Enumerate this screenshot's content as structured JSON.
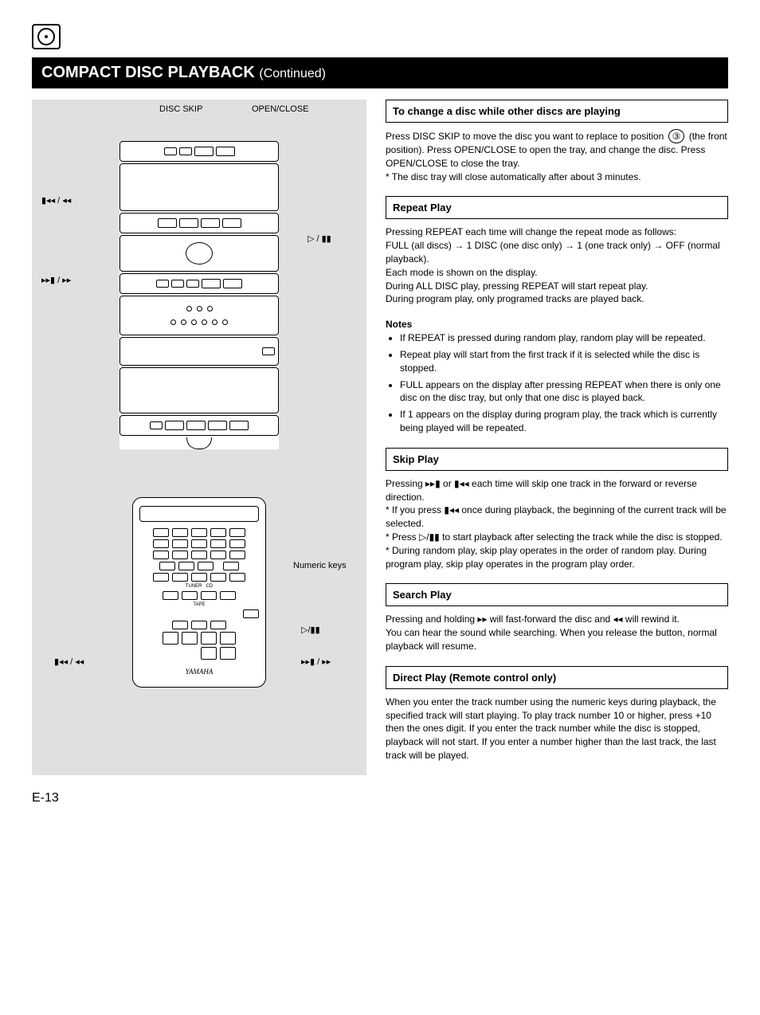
{
  "header": {
    "title_main": "COMPACT DISC PLAYBACK",
    "title_sub": "(Continued)"
  },
  "left": {
    "callouts": {
      "disc_skip": "DISC SKIP",
      "open_close": "OPEN/CLOSE",
      "skip_prev": "▮◂◂ / ◂◂",
      "skip_next": "▸▸▮ / ▸▸",
      "play_pause": "▷ / ▮▮",
      "numeric_keys": "Numeric keys",
      "remote_skip_prev": "▮◂◂ / ◂◂",
      "remote_skip_next": "▸▸▮ / ▸▸",
      "remote_play_pause": "▷/▮▮"
    },
    "brand": "YAMAHA"
  },
  "sections": {
    "change_while_playing": {
      "title": "To change a disc while other discs are  playing",
      "body_1": "Press DISC SKIP to move the disc you want to replace to position ",
      "circled": "③",
      "body_2": " (the front position). Press OPEN/CLOSE to open the tray, and change the disc. Press OPEN/CLOSE to close the tray.",
      "body_3": "* The disc tray will close automatically after about 3 minutes."
    },
    "repeat": {
      "title": "Repeat Play",
      "body_1": "Pressing REPEAT each time will change the repeat mode as follows:",
      "seq": "FULL (all discs) → 1 DISC (one disc only) → 1 (one track only) → OFF (normal playback).",
      "body_2": "Each mode is shown on the display.",
      "body_3": "During ALL DISC play, pressing REPEAT will start repeat play.",
      "body_4": "During program play, only programed tracks are played back.",
      "notes_title": "Notes",
      "notes": [
        "If REPEAT is pressed during random play, random play will be repeated.",
        "Repeat play will start from the first track if it is selected while the disc is stopped.",
        "FULL appears on the display after pressing REPEAT when there is only one disc on the disc tray, but only that one disc is played back.",
        "If 1 appears on the display during program play, the track which is currently being played will be repeated."
      ]
    },
    "skip": {
      "title": "Skip Play",
      "body_1_a": "Pressing ",
      "fwd1": "▸▸▮",
      "body_1_b": " or ",
      "rev1": "▮◂◂",
      "body_1_c": " each time will skip one track in the forward or reverse direction.",
      "body_2_a": "* If you press ",
      "rev2": "▮◂◂",
      "body_2_b": " once during playback, the beginning of the current track will be selected.",
      "body_3_a": "* Press ",
      "play_pause": "▷/▮▮",
      "body_3_b": " to start playback after selecting the track while the disc is stopped.",
      "body_4": "* During random play, skip play operates in the order of random play. During program play, skip play operates in the program play order."
    },
    "search": {
      "title": "Search Play",
      "body_1_a": "Pressing and holding ",
      "fwd": "▸▸",
      "body_1_b": " will fast-forward the disc and ",
      "rev": "◂◂",
      "body_1_c": " will rewind it.",
      "body_2": "You can hear the sound while searching. When you release the button, normal playback will resume."
    },
    "direct": {
      "title": "Direct Play (Remote control only)",
      "body": "When you enter the track number using the numeric keys during playback, the specified track will start playing. To play track number 10 or higher, press +10 then the ones digit. If you enter the track number while the disc is stopped, playback will not start. If you enter a number higher than the last track, the last track will be played."
    }
  },
  "page_number": "E-13"
}
